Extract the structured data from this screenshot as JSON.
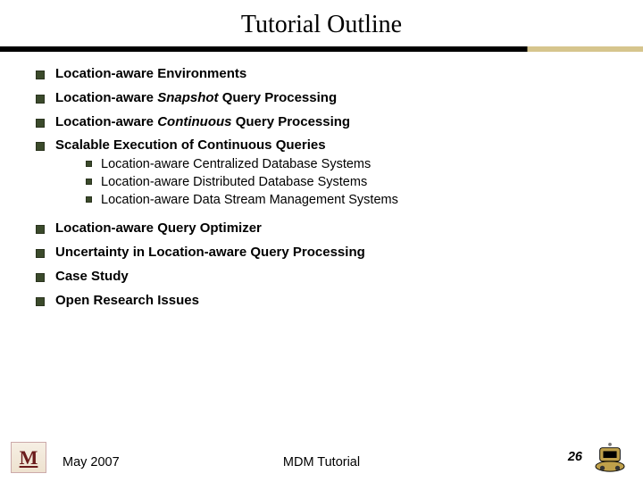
{
  "title": "Tutorial Outline",
  "bullets": {
    "b1": "Location-aware Environments",
    "b2_pre": "Location-aware ",
    "b2_em": "Snapshot",
    "b2_post": " Query Processing",
    "b3_pre": "Location-aware ",
    "b3_em": "Continuous",
    "b3_post": " Query Processing",
    "b4": "Scalable Execution of Continuous Queries",
    "b4a": "Location-aware Centralized Database Systems",
    "b4b": "Location-aware Distributed Database Systems",
    "b4c": "Location-aware Data Stream Management Systems",
    "b5": "Location-aware Query Optimizer",
    "b6": "Uncertainty in Location-aware Query Processing",
    "b7": "Case Study",
    "b8": "Open Research Issues"
  },
  "footer": {
    "date": "May 2007",
    "center": "MDM Tutorial",
    "page": "26"
  },
  "logos": {
    "mn_letter": "M"
  }
}
